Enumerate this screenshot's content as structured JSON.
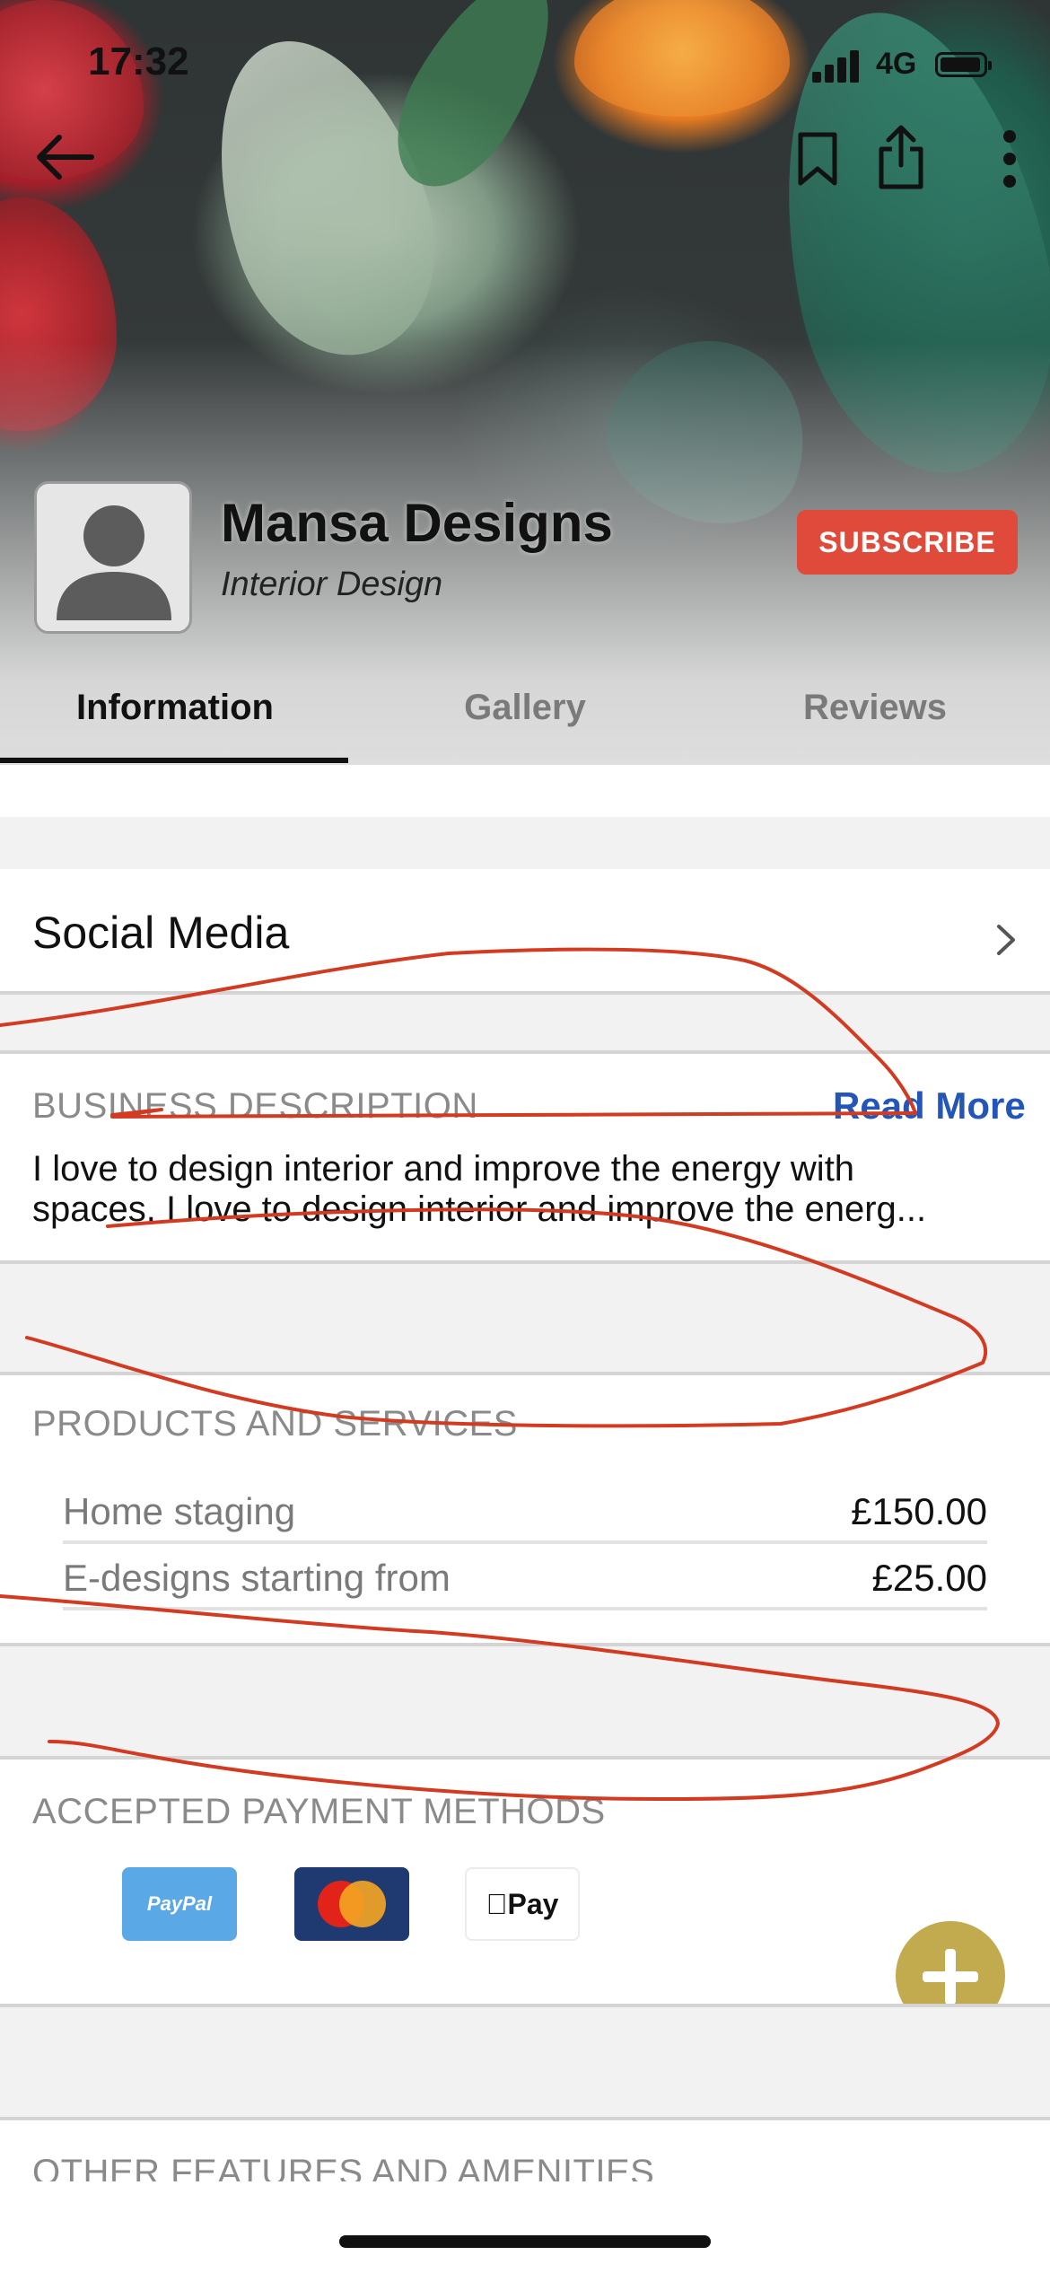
{
  "status_bar": {
    "time": "17:32",
    "network": "4G"
  },
  "nav": {
    "back_icon": "arrow-left-icon",
    "bookmark_icon": "bookmark-icon",
    "share_icon": "share-icon",
    "more_icon": "more-vertical-icon"
  },
  "profile": {
    "name": "Mansa Designs",
    "category": "Interior Design",
    "subscribe_label": "SUBSCRIBE"
  },
  "tabs": [
    {
      "label": "Information",
      "active": true
    },
    {
      "label": "Gallery",
      "active": false
    },
    {
      "label": "Reviews",
      "active": false
    }
  ],
  "social_media": {
    "label": "Social Media"
  },
  "business_description": {
    "heading": "BUSINESS DESCRIPTION",
    "read_more": "Read More",
    "line1": "I love to design interior and improve the energy with",
    "line2": "spaces. I love to design interior and improve the energ..."
  },
  "products": {
    "heading": "PRODUCTS AND SERVICES",
    "items": [
      {
        "name": "Home staging",
        "price": "£150.00"
      },
      {
        "name": "E-designs starting from",
        "price": "£25.00"
      }
    ]
  },
  "payment": {
    "heading": "ACCEPTED PAYMENT METHODS",
    "methods": [
      {
        "name": "PayPal",
        "label": "PayPal"
      },
      {
        "name": "MasterCard",
        "label": "MasterCard"
      },
      {
        "name": "Apple Pay",
        "label": "Pay"
      }
    ]
  },
  "other_features": {
    "heading": "OTHER FEATURES AND AMENITIES"
  },
  "colors": {
    "accent_red": "#e04a3a",
    "link_blue": "#2456b8",
    "fab_gold": "#c2ab4e",
    "annotation_red": "#d23a22"
  },
  "fab": {
    "icon": "plus-icon"
  }
}
